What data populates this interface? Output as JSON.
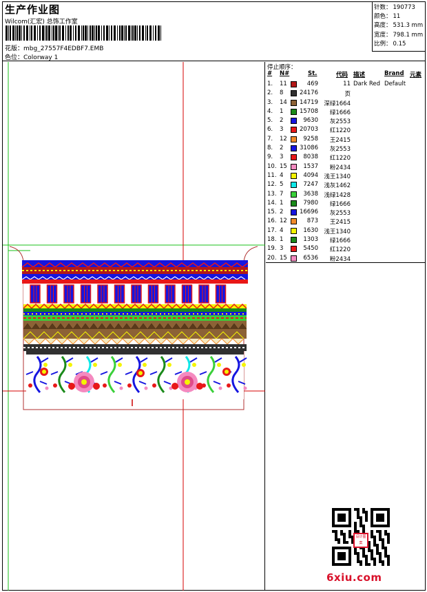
{
  "header": {
    "title": "生产作业图",
    "company": "Wilcom(汇宏) 总饰工作室",
    "design_label": "花版：",
    "design_file": "mbg_27557F4EDBF7.EMB",
    "color_label": "色位：",
    "colorway": "Colorway 1"
  },
  "stats": [
    {
      "label": "针数：",
      "value": "190773"
    },
    {
      "label": "颜色：",
      "value": "11"
    },
    {
      "label": "高度：",
      "value": "531.3 mm"
    },
    {
      "label": "宽度：",
      "value": "798.1 mm"
    },
    {
      "label": "比例：",
      "value": "0.15"
    }
  ],
  "order": {
    "title": "停止顺序：",
    "columns": {
      "num": "#",
      "needle": "N#",
      "stitches": "St.",
      "code": "代码",
      "desc": "描述",
      "brand": "Brand",
      "element": "元素"
    },
    "rows": [
      {
        "num": "1.",
        "needle": "11",
        "color": "#b31818",
        "stitches": "469",
        "code": "11",
        "desc": "Dark Red",
        "brand": "Default"
      },
      {
        "num": "2.",
        "needle": "8",
        "color": "#303030",
        "stitches": "24176",
        "code": "页",
        "desc": "",
        "brand": ""
      },
      {
        "num": "3.",
        "needle": "14",
        "color": "#8c6236",
        "stitches": "14719",
        "code": "深绿1664",
        "desc": "",
        "brand": ""
      },
      {
        "num": "4.",
        "needle": "1",
        "color": "#1a8a1a",
        "stitches": "15708",
        "code": "绿1666",
        "desc": "",
        "brand": ""
      },
      {
        "num": "5.",
        "needle": "2",
        "color": "#1515e0",
        "stitches": "9630",
        "code": "灰2553",
        "desc": "",
        "brand": ""
      },
      {
        "num": "6.",
        "needle": "3",
        "color": "#e81818",
        "stitches": "20703",
        "code": "红1220",
        "desc": "",
        "brand": ""
      },
      {
        "num": "7.",
        "needle": "12",
        "color": "#f08a2a",
        "stitches": "9258",
        "code": "王2415",
        "desc": "",
        "brand": ""
      },
      {
        "num": "8.",
        "needle": "2",
        "color": "#1515e0",
        "stitches": "31086",
        "code": "灰2553",
        "desc": "",
        "brand": ""
      },
      {
        "num": "9.",
        "needle": "3",
        "color": "#e81818",
        "stitches": "8038",
        "code": "红1220",
        "desc": "",
        "brand": ""
      },
      {
        "num": "10.",
        "needle": "15",
        "color": "#f48ac0",
        "stitches": "1537",
        "code": "粉2434",
        "desc": "",
        "brand": ""
      },
      {
        "num": "11.",
        "needle": "4",
        "color": "#f4f400",
        "stitches": "4094",
        "code": "浅王1340",
        "desc": "",
        "brand": ""
      },
      {
        "num": "12.",
        "needle": "5",
        "color": "#10e8e8",
        "stitches": "7247",
        "code": "浅灰1462",
        "desc": "",
        "brand": ""
      },
      {
        "num": "13.",
        "needle": "7",
        "color": "#3ad03a",
        "stitches": "3638",
        "code": "浅绿1428",
        "desc": "",
        "brand": ""
      },
      {
        "num": "14.",
        "needle": "1",
        "color": "#1a8a1a",
        "stitches": "7980",
        "code": "绿1666",
        "desc": "",
        "brand": ""
      },
      {
        "num": "15.",
        "needle": "2",
        "color": "#1515e0",
        "stitches": "16696",
        "code": "灰2553",
        "desc": "",
        "brand": ""
      },
      {
        "num": "16.",
        "needle": "12",
        "color": "#f08a2a",
        "stitches": "873",
        "code": "王2415",
        "desc": "",
        "brand": ""
      },
      {
        "num": "17.",
        "needle": "4",
        "color": "#f4f400",
        "stitches": "1630",
        "code": "浅王1340",
        "desc": "",
        "brand": ""
      },
      {
        "num": "18.",
        "needle": "1",
        "color": "#1a8a1a",
        "stitches": "1303",
        "code": "绿1666",
        "desc": "",
        "brand": ""
      },
      {
        "num": "19.",
        "needle": "3",
        "color": "#e81818",
        "stitches": "5450",
        "code": "红1220",
        "desc": "",
        "brand": ""
      },
      {
        "num": "20.",
        "needle": "15",
        "color": "#f48ac0",
        "stitches": "6536",
        "code": "粉2434",
        "desc": "",
        "brand": ""
      }
    ]
  },
  "watermark": "6xiu.com",
  "qr_stamp": "设计图案",
  "colors": {
    "guide_green": "#19c219",
    "guide_red": "#d40000",
    "blue": "#1515e0",
    "red": "#e81818"
  }
}
